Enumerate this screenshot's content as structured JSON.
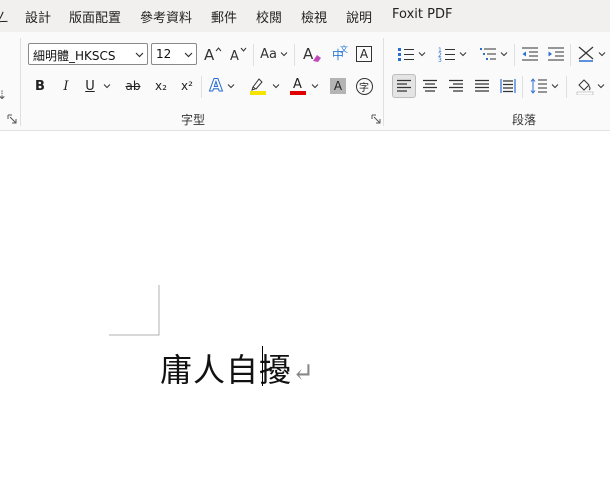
{
  "menu": {
    "partial": "ㄥ",
    "items": [
      "設計",
      "版面配置",
      "參考資料",
      "郵件",
      "校閱",
      "檢視",
      "說明",
      "Foxit PDF"
    ]
  },
  "font_group": {
    "font_name": "細明體_HKSCS",
    "font_size": "12",
    "label": "字型",
    "case_label": "Aa",
    "bold": "B",
    "italic": "I",
    "underline": "U",
    "strike": "ab",
    "subscript": "x₂",
    "superscript": "x²",
    "text_effects": "A",
    "font_color": "A",
    "char_shading": "A",
    "enclose_char": "字",
    "border_char": "A",
    "phonetic": "中",
    "highlight_color": "#f5e400",
    "font_color_value": "#e00000"
  },
  "paragraph_group": {
    "label": "段落"
  },
  "document": {
    "text": "庸人自擾",
    "para_mark": "↵"
  }
}
